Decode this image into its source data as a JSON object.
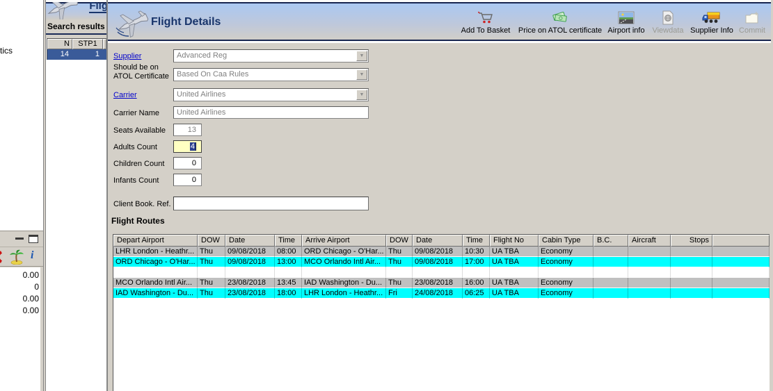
{
  "window": {
    "title": "Flight Details"
  },
  "left_panel": {
    "stat_text": "tics",
    "values": [
      "0.00",
      "0",
      "0.00",
      "0.00"
    ],
    "icons": [
      "red-partial-icon",
      "palm-tree-icon",
      "info-icon",
      "minimize-icon",
      "maximize-icon"
    ],
    "info_glyph": "i"
  },
  "sidebar": {
    "behind_window_title": "Flig",
    "section_title": "Search results",
    "results_table": {
      "headers": [
        "N",
        "STP1"
      ],
      "row": [
        "14",
        "1"
      ]
    }
  },
  "toolbar": {
    "items": [
      {
        "label": "Add To Basket",
        "icon": "basket-cart-icon",
        "disabled": false
      },
      {
        "label": "Price on ATOL certificate",
        "icon": "money-notes-icon",
        "disabled": false
      },
      {
        "label": "Airport info",
        "icon": "landscape-photo-icon",
        "disabled": false
      },
      {
        "label": "Viewdata",
        "icon": "document-globe-icon",
        "disabled": true
      },
      {
        "label": "Supplier Info",
        "icon": "truck-icon",
        "disabled": false
      },
      {
        "label": "Commit",
        "icon": "folder-plus-icon",
        "disabled": true
      }
    ]
  },
  "form": {
    "supplier": {
      "label": "Supplier",
      "value": "Advanced Reg"
    },
    "atol": {
      "label_line1": "Should be on",
      "label_line2": "ATOL Certificate",
      "value": "Based On Caa Rules"
    },
    "carrier": {
      "label": "Carrier",
      "value": "United Airlines"
    },
    "carrier_name": {
      "label": "Carrier Name",
      "value": "United Airlines"
    },
    "seats": {
      "label": "Seats Available",
      "value": "13"
    },
    "adults": {
      "label": "Adults Count",
      "value": "4"
    },
    "children": {
      "label": "Children Count",
      "value": "0"
    },
    "infants": {
      "label": "Infants Count",
      "value": "0"
    },
    "client_ref": {
      "label": "Client Book. Ref.",
      "value": ""
    }
  },
  "routes": {
    "section_title": "Flight Routes",
    "columns": [
      "Depart Airport",
      "DOW",
      "Date",
      "Time",
      "Arrive Airport",
      "DOW",
      "Date",
      "Time",
      "Flight No",
      "Cabin Type",
      "B.C.",
      "Aircraft",
      "Stops"
    ],
    "rows": [
      {
        "style": "silver",
        "full": true,
        "cells": [
          "LHR London - Heathr...",
          "Thu",
          "09/08/2018",
          "08:00",
          "ORD Chicago - O'Har...",
          "Thu",
          "09/08/2018",
          "10:30",
          "UA TBA",
          "Economy",
          "",
          "",
          ""
        ]
      },
      {
        "style": "cyan",
        "full": false,
        "cells": [
          "ORD Chicago - O'Har...",
          "Thu",
          "09/08/2018",
          "13:00",
          "MCO Orlando Intl Air...",
          "Thu",
          "09/08/2018",
          "17:00",
          "UA TBA",
          "Economy",
          "",
          "",
          ""
        ]
      },
      {
        "style": "empty",
        "full": false,
        "cells": [
          "",
          "",
          "",
          "",
          "",
          "",
          "",
          "",
          "",
          "",
          "",
          "",
          ""
        ]
      },
      {
        "style": "silver",
        "full": false,
        "cells": [
          "MCO Orlando Intl Air...",
          "Thu",
          "23/08/2018",
          "13:45",
          "IAD Washington - Du...",
          "Thu",
          "23/08/2018",
          "16:00",
          "UA TBA",
          "Economy",
          "",
          "",
          ""
        ]
      },
      {
        "style": "cyan",
        "full": false,
        "cells": [
          "IAD Washington - Du...",
          "Thu",
          "23/08/2018",
          "18:00",
          "LHR London - Heathr...",
          "Fri",
          "24/08/2018",
          "06:25",
          "UA TBA",
          "Economy",
          "",
          "",
          ""
        ]
      }
    ]
  },
  "colors": {
    "accent_navy": "#16244f",
    "title_navy": "#19356b",
    "row_silver": "#c0c0c0",
    "row_cyan": "#00ffff",
    "selection_blue": "#3a5b99",
    "adults_highlight": "#ffffc2",
    "chrome_gray": "#d4d0c8"
  }
}
